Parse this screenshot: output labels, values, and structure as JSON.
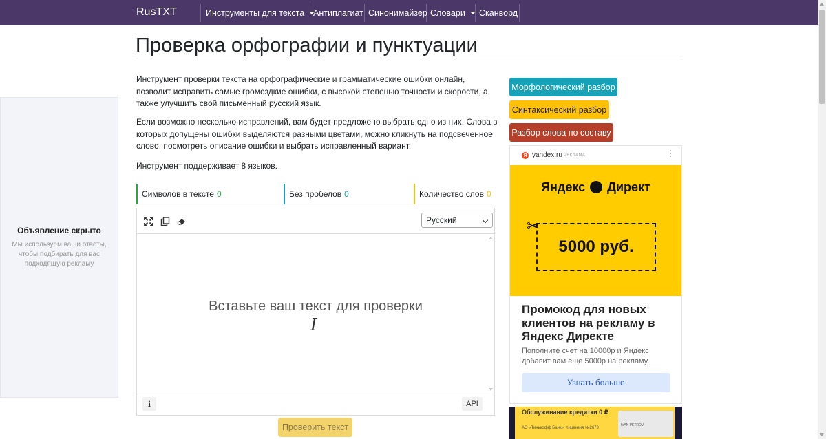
{
  "navbar": {
    "brand": "RusTXT",
    "items": [
      {
        "label": "Инструменты для текста",
        "dropdown": true
      },
      {
        "label": "Антиплагиат",
        "dropdown": false
      },
      {
        "label": "Синонимайзер",
        "dropdown": false
      },
      {
        "label": "Словари",
        "dropdown": true
      },
      {
        "label": "Сканворд",
        "dropdown": false
      }
    ],
    "bg_color": "#4b3868"
  },
  "page": {
    "title": "Проверка орфографии и пунктуации",
    "paragraphs": [
      "Инструмент проверки текста на орфографические и грамматические ошибки онлайн, позволит исправить самые громоздкие ошибки, с высокой степенью точности и скорости, а также улучшить свой письменный русский язык.",
      "Если возможно несколько исправлений, вам будет предложено выбрать одно из них. Слова в которых допущены ошибки выделяются разными цветами, можно кликнуть на подсвеченное слово, посмотреть описание ошибки и выбрать исправленный вариант.",
      "Инструмент поддерживает 8 языков."
    ]
  },
  "left_ad": {
    "title": "Объявление скрыто",
    "text": "Мы используем ваши ответы, чтобы подбирать для вас подходящую рекламу"
  },
  "counters": [
    {
      "label": "Символов в тексте",
      "value": "0",
      "color": "#28a745"
    },
    {
      "label": "Без пробелов",
      "value": "0",
      "color": "#17a2b8"
    },
    {
      "label": "Количество слов",
      "value": "0",
      "color": "#ffc107"
    }
  ],
  "editor": {
    "toolbar_icons": [
      "fullscreen-icon",
      "copy-icon",
      "eraser-icon"
    ],
    "language": "Русский",
    "placeholder": "Вставьте ваш текст для проверки",
    "info_label": "i",
    "api_label": "API",
    "check_button": "Проверить текст"
  },
  "side_buttons": [
    {
      "label": "Морфологический разбор",
      "bg": "#17a2b8",
      "fg": "#ffffff"
    },
    {
      "label": "Синтаксический разбор",
      "bg": "#ffc107",
      "fg": "#212529"
    },
    {
      "label": "Разбор слова по составу",
      "bg": "#b5402a",
      "fg": "#ffffff"
    }
  ],
  "yandex_ad": {
    "logo_letter": "Я",
    "domain": "yandex.ru",
    "ad_label": "РЕКЛАМА",
    "brand_left": "Яндекс",
    "brand_right": "Директ",
    "amount": "5000 руб.",
    "headline": "Промокод для новых клиентов на рекламу в Яндекс Директе",
    "body": "Пополните счет на 10000р и Яндекс добавит вам еще 5000р на рекламу",
    "cta": "Узнать больше",
    "banner_color": "#ffcc00"
  },
  "second_ad": {
    "text": "Обслуживание кредитки 0 ₽",
    "card_name": "IVAN PETROV",
    "bank_text": "АО «Тинькофф Банк», лицензия №2673"
  }
}
